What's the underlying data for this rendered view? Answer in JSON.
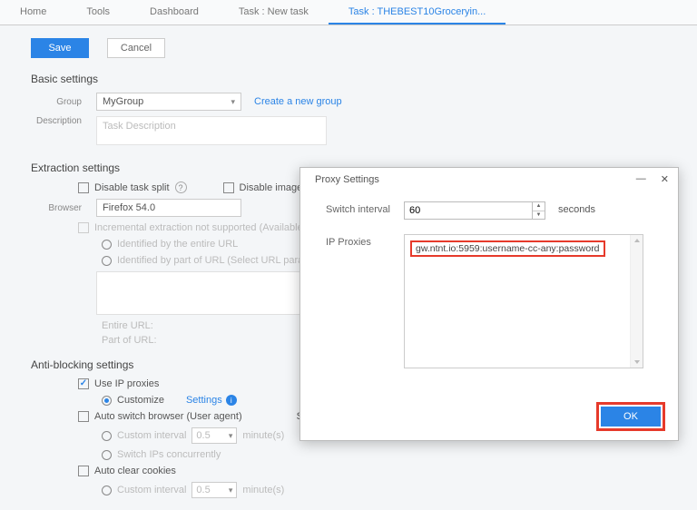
{
  "tabs": {
    "home": "Home",
    "tools": "Tools",
    "dashboard": "Dashboard",
    "newtask": "Task : New task",
    "active": "Task : THEBEST10Groceryin..."
  },
  "actions": {
    "save": "Save",
    "cancel": "Cancel"
  },
  "basic": {
    "heading": "Basic settings",
    "group_label": "Group",
    "group_value": "MyGroup",
    "create_group": "Create a new group",
    "desc_label": "Description",
    "desc_placeholder": "Task Description"
  },
  "extraction": {
    "heading": "Extraction settings",
    "disable_split": "Disable task split",
    "disable_image": "Disable image loading",
    "browser_label": "Browser",
    "browser_value": "Firefox 54.0",
    "incremental": "Incremental extraction not supported (Available only when the ",
    "by_entire": "Identified by the entire URL",
    "by_part": "Identified by part of URL (Select URL parameters)",
    "entire_url": "Entire URL:",
    "part_url": "Part of URL:"
  },
  "anti": {
    "heading": "Anti-blocking settings",
    "use_proxies": "Use IP proxies",
    "customize": "Customize",
    "settings": "Settings",
    "auto_switch": "Auto switch browser (User agent)",
    "custom_interval": "Custom interval",
    "interval_val": "0.5",
    "minutes": "minute(s)",
    "switch_concurrent": "Switch IPs concurrently",
    "auto_clear": "Auto clear cookies"
  },
  "dialog": {
    "title": "Proxy Settings",
    "switch_label": "Switch interval",
    "switch_value": "60",
    "seconds": "seconds",
    "proxies_label": "IP Proxies",
    "proxy_line": "gw.ntnt.io:5959:username-cc-any:password",
    "ok": "OK"
  }
}
